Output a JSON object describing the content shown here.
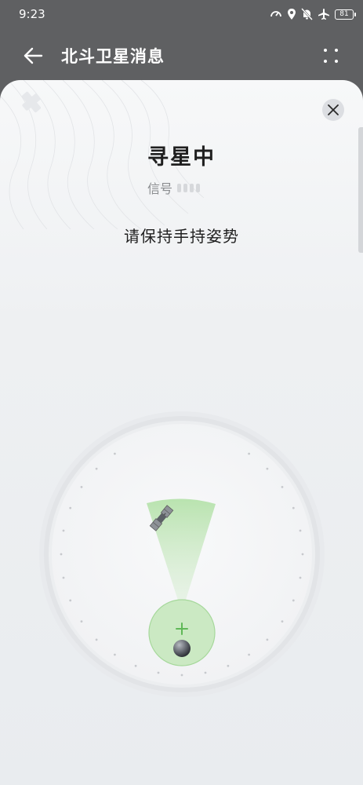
{
  "status_bar": {
    "time": "9:23",
    "battery_level": "81",
    "icons": [
      "speed-meter-icon",
      "location-pin-icon",
      "silent-bell-icon",
      "airplane-icon",
      "battery-icon"
    ]
  },
  "header": {
    "title": "北斗卫星消息",
    "back_icon": "arrow-left-icon",
    "more_icon": "more-dots-icon"
  },
  "search": {
    "status": "寻星中",
    "signal_label": "信号",
    "signal_level": 0,
    "signal_max": 4,
    "instruction": "请保持手持姿势"
  },
  "compass": {
    "satellite_icon": "satellite-icon",
    "center_icon": "plus-icon",
    "tick_count": 32
  },
  "colors": {
    "accent_green": "#a9dca0",
    "header_bg": "#5f6062",
    "card_bg": "#f3f4f6"
  }
}
